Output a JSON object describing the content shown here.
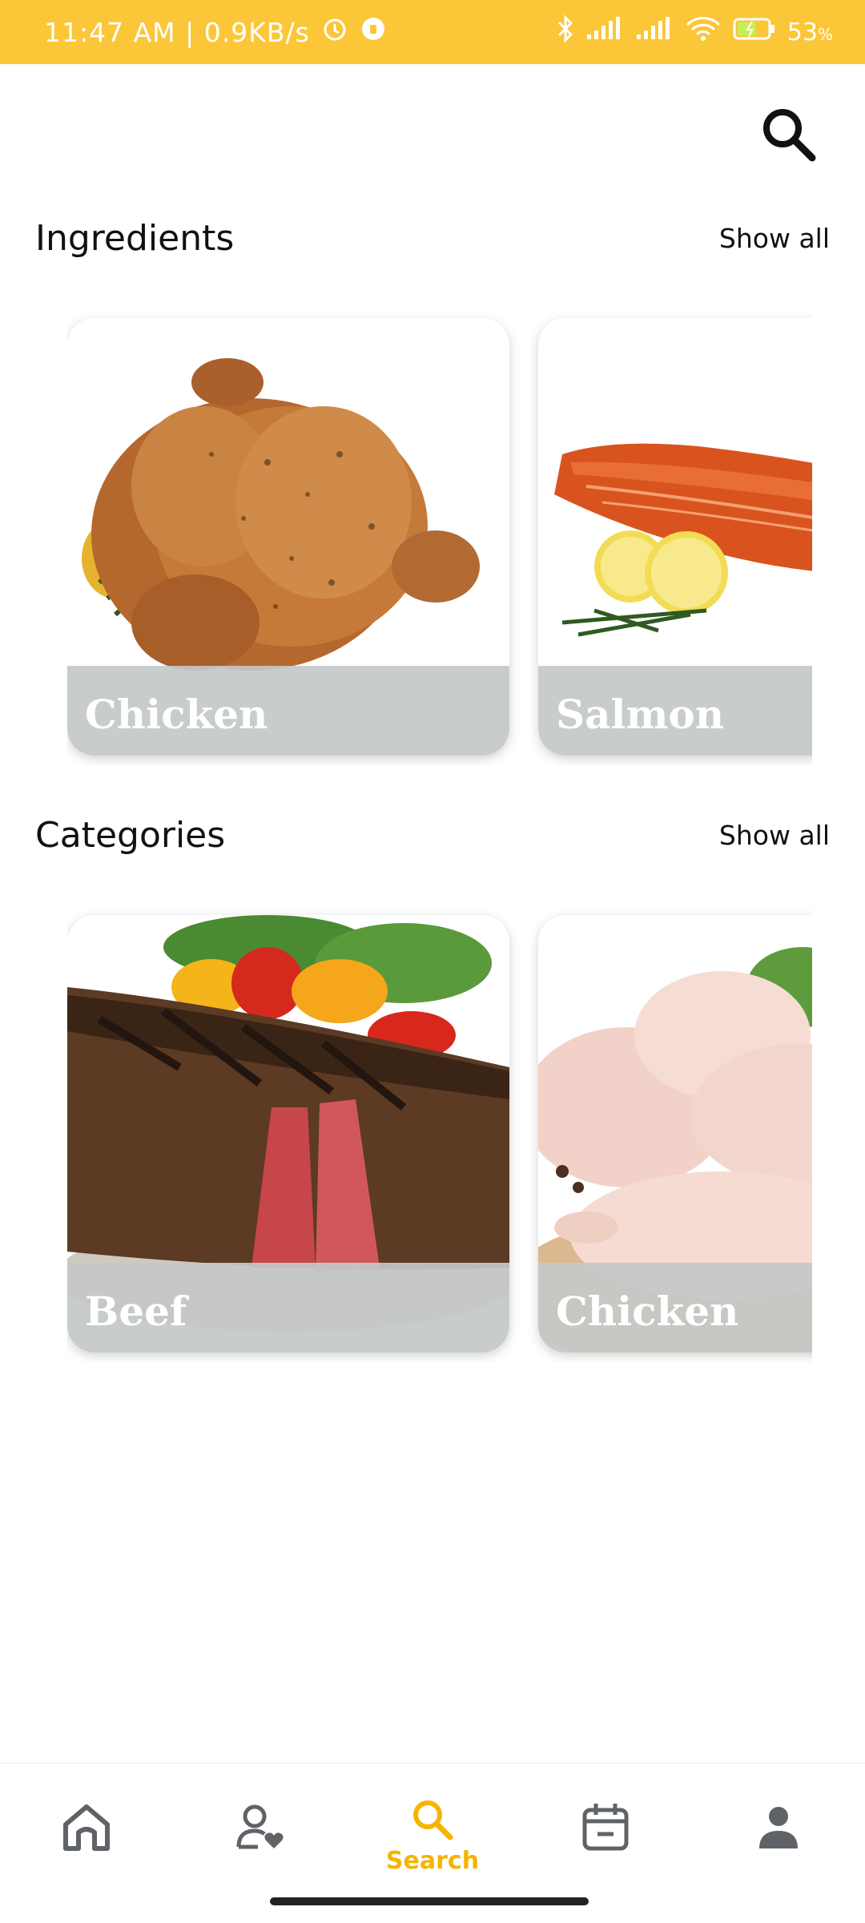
{
  "status_bar": {
    "time": "11:47 AM | 0.9KB/s",
    "battery": "53",
    "battery_unit": "%"
  },
  "sections": {
    "ingredients": {
      "title": "Ingredients",
      "show_all": "Show all",
      "cards": [
        {
          "label": "Chicken",
          "image": "roast-chicken-image"
        },
        {
          "label": "Salmon",
          "image": "salmon-fillet-image"
        }
      ]
    },
    "categories": {
      "title": "Categories",
      "show_all": "Show all",
      "cards": [
        {
          "label": "Beef",
          "image": "grilled-steak-image"
        },
        {
          "label": "Chicken",
          "image": "raw-chicken-image"
        }
      ]
    }
  },
  "bottom_nav": {
    "items": [
      {
        "name": "home",
        "icon": "home-icon",
        "label": ""
      },
      {
        "name": "favorites",
        "icon": "user-heart-icon",
        "label": ""
      },
      {
        "name": "search",
        "icon": "search-icon",
        "label": "Search",
        "active": true
      },
      {
        "name": "planner",
        "icon": "calendar-icon",
        "label": ""
      },
      {
        "name": "profile",
        "icon": "person-icon",
        "label": ""
      }
    ]
  },
  "colors": {
    "accent": "#fbc638",
    "active_nav": "#f5b400",
    "label_band": "#c4c8c8",
    "icon_gray": "#5f6368"
  }
}
